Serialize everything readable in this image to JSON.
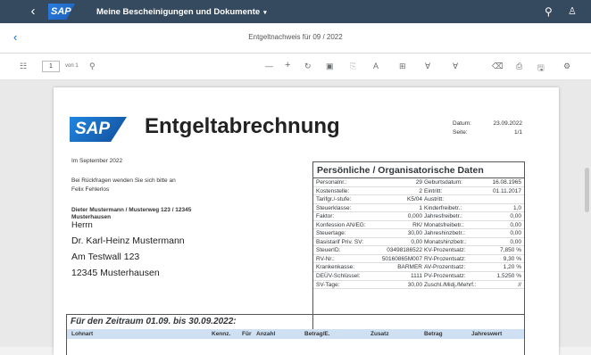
{
  "shell": {
    "back_icon": "chevron-left-icon",
    "logo": "SAP",
    "title": "Meine Bescheinigungen und Dokumente",
    "caret": "▾",
    "search_icon": "⚲",
    "user_icon": "♙"
  },
  "subheader": {
    "back": "‹",
    "title": "Entgeltnachweis für 09 / 2022"
  },
  "toolbar": {
    "sidebar_icon": "☷",
    "page_value": "1",
    "page_of": "von 1",
    "search_icon": "⚲",
    "zoom_out": "—",
    "zoom_in": "+",
    "rotate": "↻",
    "fit": "▣",
    "copy": "⎘",
    "text": "A",
    "read": "⊞",
    "draw": "∀",
    "highlight": "∀",
    "erase": "⌫",
    "print": "⎙",
    "save": "🖫",
    "settings": "⚙"
  },
  "document": {
    "logo": "SAP",
    "heading": "Entgeltabrechnung",
    "date_label": "Datum:",
    "date_value": "23.09.2022",
    "page_label": "Seite:",
    "page_value": "1/1",
    "month": "Im September 2022",
    "contact_line1": "Bei Rückfragen wenden Sie sich bitte an",
    "contact_line2": "Felix Fehlerlos",
    "sender_line1": "Dieter Mustermann / Musterweg 123 / 12345",
    "sender_line2": "Musterhausen",
    "salutation": "Herrn",
    "name": "Dr. Karl-Heinz Mustermann",
    "street": "Am Testwall 123",
    "city": "12345 Musterhausen"
  },
  "personal": {
    "title": "Persönliche / Organisatorische Daten",
    "rows": [
      {
        "l1": "Personalnr.:",
        "v1": "29",
        "l2": "Geburtsdatum:",
        "v2": "16.08.1965"
      },
      {
        "l1": "Kostenstelle:",
        "v1": "2",
        "l2": "Eintritt:",
        "v2": "01.11.2017"
      },
      {
        "l1": "Tarifgr./-stufe:",
        "v1": "K5/04",
        "l2": "Austritt:",
        "v2": ""
      },
      {
        "l1": "Steuerklasse:",
        "v1": "1",
        "l2": "Kinderfreibetr.:",
        "v2": "1,0"
      },
      {
        "l1": "Faktor:",
        "v1": "0,000",
        "l2": "Jahresfreibetr.:",
        "v2": "0,00"
      },
      {
        "l1": "Konfession AN/EG:",
        "v1": "RK/",
        "l2": "Monatsfreibetr.:",
        "v2": "0,00"
      },
      {
        "l1": "Steuertage:",
        "v1": "30,00",
        "l2": "Jahreshinzbetr.:",
        "v2": "0,00"
      },
      {
        "l1": "Basistarif Priv. SV:",
        "v1": "0,00",
        "l2": "Monatshinzbetr.:",
        "v2": "0,00"
      },
      {
        "l1": "SteuerID:",
        "v1": "03498186522",
        "l2": "KV-Prozentsatz:",
        "v2": "7,850 %"
      },
      {
        "l1": "RV-Nr.:",
        "v1": "50160865M007",
        "l2": "RV-Prozentsatz:",
        "v2": "9,30 %"
      },
      {
        "l1": "Krankenkasse:",
        "v1": "BARMER",
        "l2": "AV-Prozentsatz:",
        "v2": "1,20 %"
      },
      {
        "l1": "DEÜV-Schlüssel:",
        "v1": "1111",
        "l2": "PV-Prozentsatz:",
        "v2": "1,5250 %"
      },
      {
        "l1": "SV-Tage:",
        "v1": "30,00",
        "l2": "Zuschl./Midj./Mehrf.:",
        "v2": "//"
      }
    ]
  },
  "period": {
    "title": "Für den Zeitraum 01.09. bis 30.09.2022:",
    "columns": [
      "Lohnart",
      "Kennz.",
      "Für",
      "Anzahl",
      "Betrag/E.",
      "Zusatz",
      "Betrag",
      "Jahreswert"
    ]
  }
}
